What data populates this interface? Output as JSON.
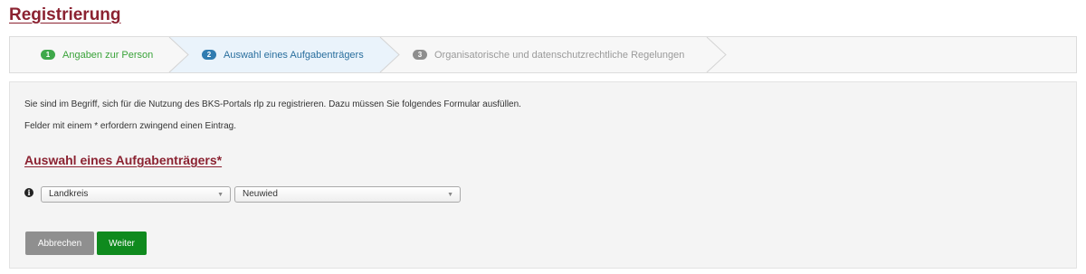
{
  "page": {
    "title": "Registrierung"
  },
  "wizard": {
    "steps": [
      {
        "number": "1",
        "label": "Angaben zur Person",
        "state": "completed"
      },
      {
        "number": "2",
        "label": "Auswahl eines Aufgabenträgers",
        "state": "active"
      },
      {
        "number": "3",
        "label": "Organisatorische und datenschutzrechtliche Regelungen",
        "state": "pending"
      }
    ]
  },
  "form": {
    "intro": "Sie sind im Begriff, sich für die Nutzung des BKS-Portals rlp zu registrieren. Dazu müssen Sie folgendes Formular ausfüllen.",
    "required_hint": "Felder mit einem * erfordern zwingend einen Eintrag.",
    "section_title": "Auswahl eines Aufgabenträgers*",
    "info_icon_glyph": "i",
    "type_select": {
      "value": "Landkreis"
    },
    "name_select": {
      "value": "Neuwied"
    },
    "dropdown_glyph": "▼"
  },
  "buttons": {
    "cancel": "Abbrechen",
    "next": "Weiter"
  },
  "colors": {
    "title": "#8b2231",
    "step_completed": "#3aa33a",
    "step_active": "#2a6f9e",
    "step_pending": "#9a9a9a",
    "button_next": "#0f8a1e",
    "button_cancel": "#8f8f8f"
  }
}
